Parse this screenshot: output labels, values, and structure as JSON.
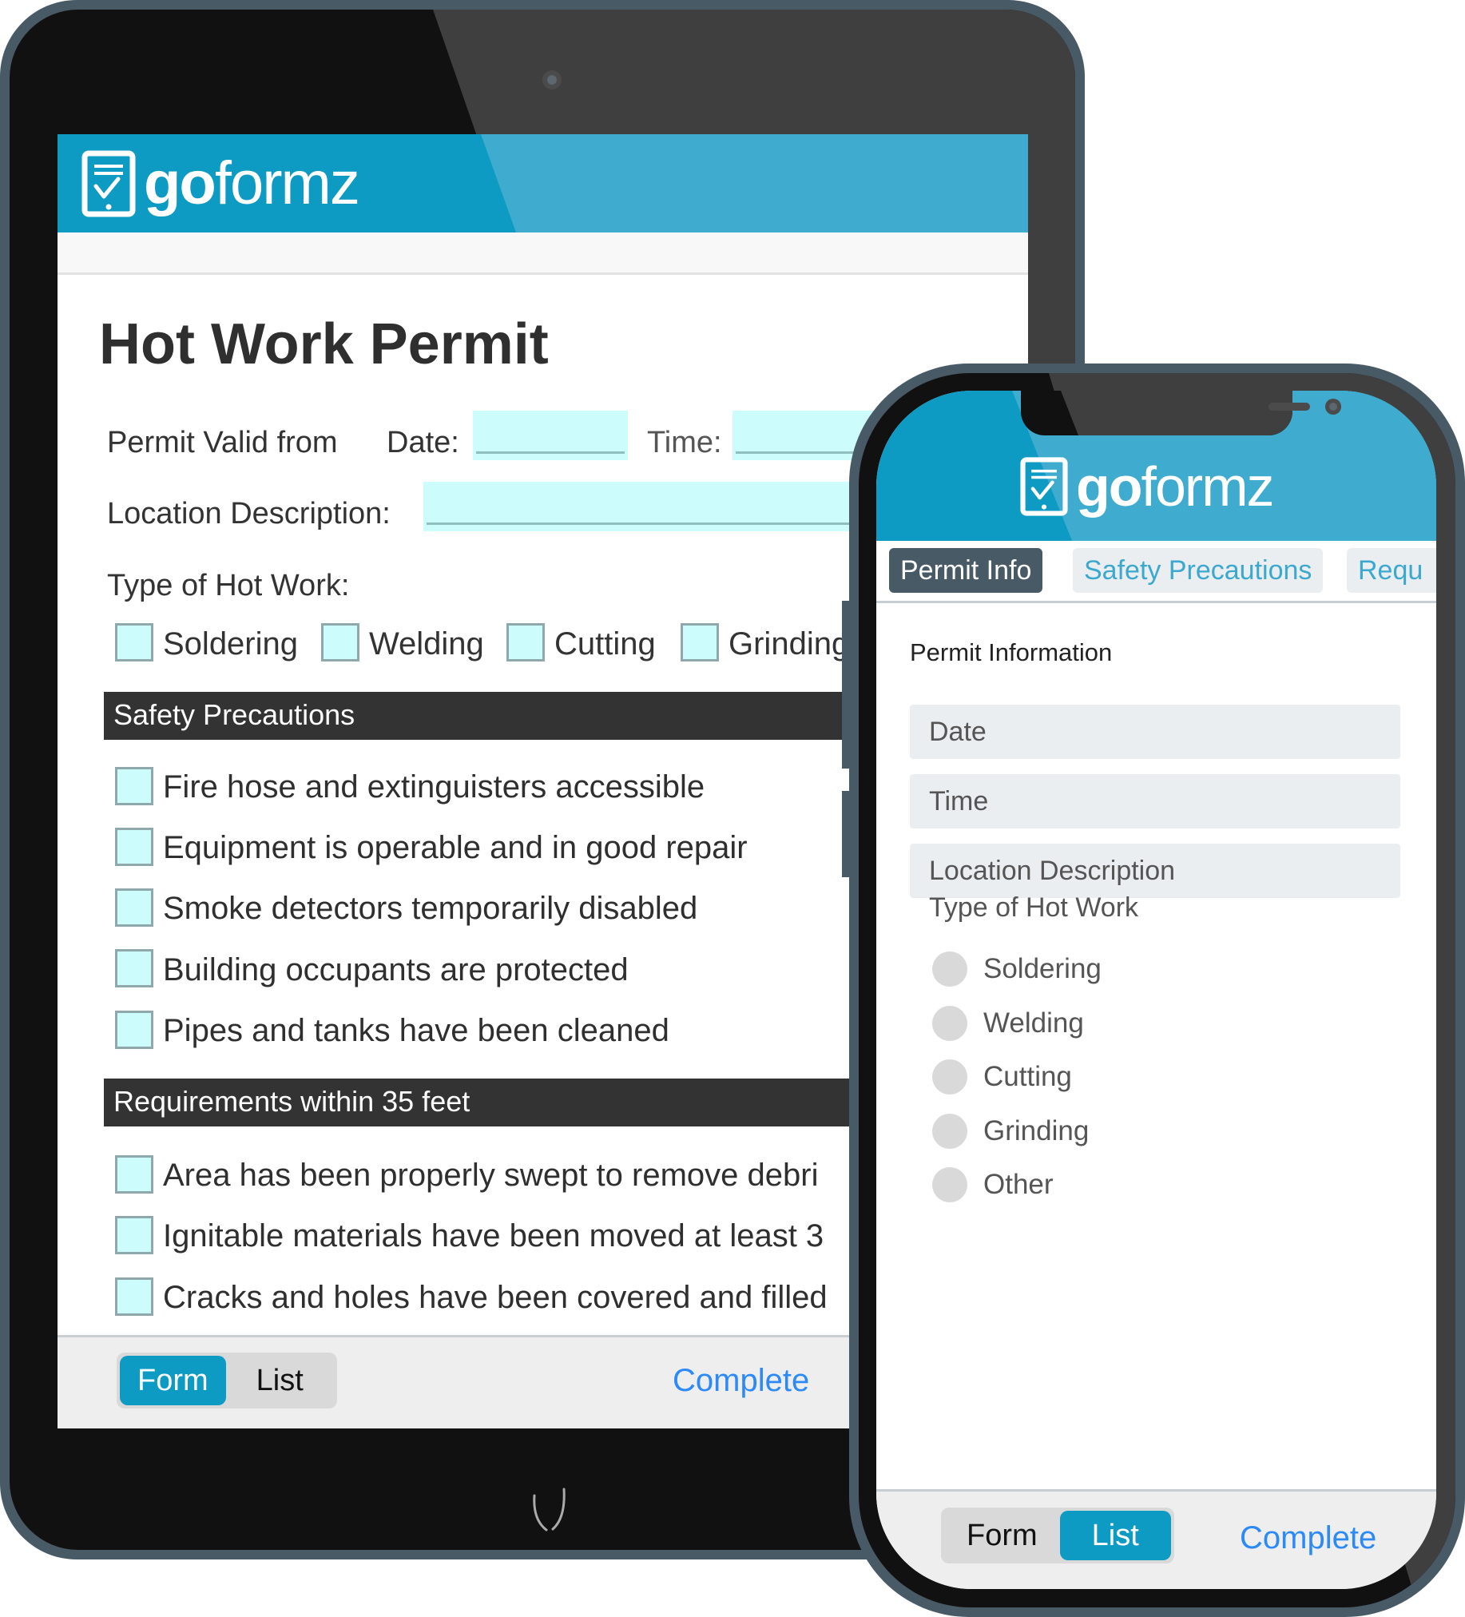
{
  "brand": {
    "name_bold": "go",
    "name_light": "formz",
    "logo_icon": "tablet-checkmark-icon",
    "colors": {
      "header_blue": "#0d9ac3",
      "header_blue_light": "#3eabcf",
      "field_cyan": "#ccfcfc",
      "section_dark": "#333333",
      "link_blue": "#2b8af7",
      "device_frame": "#475a66"
    }
  },
  "tablet": {
    "title": "Hot Work Permit",
    "permit_valid_label": "Permit Valid from",
    "date_label": "Date:",
    "date_value": "",
    "time_label": "Time:",
    "time_value": "",
    "location_label": "Location Description:",
    "location_value": "",
    "type_label": "Type of Hot Work:",
    "type_options": [
      "Soldering",
      "Welding",
      "Cutting",
      "Grinding"
    ],
    "sections": [
      {
        "title": "Safety Precautions",
        "items": [
          "Fire hose and extinguisters accessible",
          "Equipment is operable and in good repair",
          "Smoke detectors temporarily disabled",
          "Building occupants are protected",
          "Pipes and tanks have been cleaned"
        ]
      },
      {
        "title": "Requirements within 35 feet",
        "items": [
          "Area has been properly swept to remove debri",
          "Ignitable materials have been moved at least 3",
          "Cracks and holes have been covered and filled"
        ]
      }
    ],
    "footer": {
      "form_label": "Form",
      "list_label": "List",
      "active": "Form",
      "complete_label": "Complete"
    }
  },
  "phone": {
    "tabs": [
      {
        "label": "Permit Info",
        "active": true
      },
      {
        "label": "Safety Precautions",
        "active": false
      },
      {
        "label": "Requ",
        "active": false
      }
    ],
    "section_title": "Permit Information",
    "fields": [
      {
        "placeholder": "Date"
      },
      {
        "placeholder": "Time"
      },
      {
        "placeholder": "Location Description"
      }
    ],
    "type_label": "Type of Hot Work",
    "type_options": [
      "Soldering",
      "Welding",
      "Cutting",
      "Grinding",
      "Other"
    ],
    "footer": {
      "form_label": "Form",
      "list_label": "List",
      "active": "List",
      "complete_label": "Complete"
    }
  }
}
